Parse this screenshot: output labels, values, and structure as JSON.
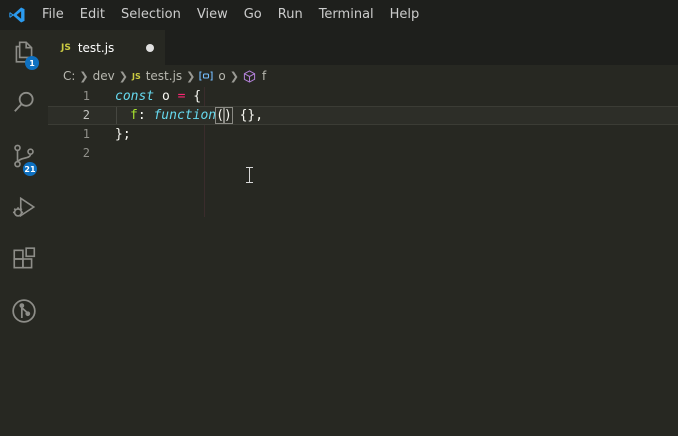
{
  "menu": [
    "File",
    "Edit",
    "Selection",
    "View",
    "Go",
    "Run",
    "Terminal",
    "Help"
  ],
  "activity_bar": {
    "items": [
      {
        "name": "explorer",
        "icon": "files-icon",
        "badge": "1"
      },
      {
        "name": "search",
        "icon": "search-icon",
        "badge": ""
      },
      {
        "name": "source-control",
        "icon": "source-control-icon",
        "badge": "21"
      },
      {
        "name": "run-debug",
        "icon": "run-debug-icon",
        "badge": ""
      },
      {
        "name": "extensions",
        "icon": "extensions-icon",
        "badge": ""
      },
      {
        "name": "git-graph",
        "icon": "git-graph-icon",
        "badge": ""
      }
    ]
  },
  "tab": {
    "file_type": "JS",
    "label": "test.js",
    "dirty": true
  },
  "breadcrumbs": {
    "drive": "C:",
    "folder": "dev",
    "file_type": "JS",
    "file": "test.js",
    "variable": "o",
    "property": "f"
  },
  "editor": {
    "lines": [
      {
        "number": "1",
        "active": false
      },
      {
        "number": "2",
        "active": true
      },
      {
        "number": "1",
        "active": false
      },
      {
        "number": "2",
        "active": false
      }
    ],
    "code": {
      "line1_kw": "const",
      "line1_name": " o ",
      "line1_op": "=",
      "line1_brace": " {",
      "line2_prop": "f",
      "line2_colon": ": ",
      "line2_kw": "function",
      "line2_open": "(",
      "line2_close": ")",
      "line2_rest": " {},",
      "line3": "};"
    }
  },
  "colors": {
    "editor_bg": "#272822",
    "keyword": "#66d9ef",
    "operator": "#f92672",
    "function": "#a6e22e",
    "badge": "#0e70c0",
    "js_icon": "#cbcb41"
  }
}
